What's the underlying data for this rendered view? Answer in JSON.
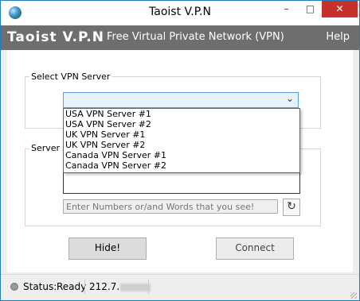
{
  "window": {
    "title": "Taoist V.P.N",
    "min_symbol": "–",
    "max_symbol": "□",
    "close_symbol": "✕"
  },
  "header": {
    "brand": "Taoist V.P.N",
    "subtitle": "Free Virtual Private Network (VPN)",
    "help": "Help"
  },
  "server_group": {
    "label": "Select VPN Server",
    "selected": "",
    "arrow": "⌄"
  },
  "dropdown": {
    "options": [
      "USA VPN Server #1",
      "USA VPN Server #2",
      "UK VPN Server #1",
      "UK VPN Server #2",
      "Canada VPN Server #1",
      "Canada VPN Server #2"
    ]
  },
  "auth_group": {
    "label": "Server A",
    "captcha_placeholder": "Enter Numbers or/and Words that you see!",
    "refresh_symbol": "↻"
  },
  "buttons": {
    "hide": "Hide!",
    "connect": "Connect"
  },
  "status": {
    "label": "Status:",
    "value": "Ready",
    "ip_prefix": "212.7."
  },
  "colors": {
    "header_bg": "#6e6e6e",
    "close_bg": "#c7302b",
    "select_border": "#5aa0dc"
  }
}
